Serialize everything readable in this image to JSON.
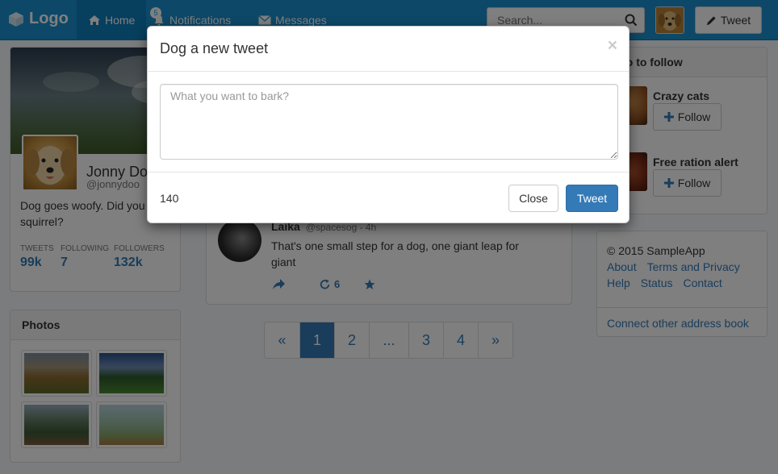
{
  "navbar": {
    "brand": "Logo",
    "brand_icon": "cube-icon",
    "home_label": "Home",
    "notifications_label": "Notifications",
    "notifications_count": "5",
    "messages_label": "Messages",
    "search_placeholder": "Search...",
    "tweet_label": "Tweet",
    "accent_color": "#1a91d1"
  },
  "profile": {
    "name": "Jonny Doo",
    "handle": "@jonnydoo",
    "bio": "Dog goes woofy. Did you said squirrel?",
    "stats": [
      {
        "label": "TWEETS",
        "value": "99k"
      },
      {
        "label": "FOLLOWING",
        "value": "7"
      },
      {
        "label": "FOLLOWERS",
        "value": "132k"
      }
    ]
  },
  "photos": {
    "title": "Photos"
  },
  "tweet": {
    "author": "Laika",
    "handle_time": "@spacesog - 4h",
    "text": "That's one small step for a dog, one giant leap for giant",
    "retweet_count": "6"
  },
  "pagination": {
    "prev": "«",
    "pages": [
      "1",
      "2",
      "...",
      "3",
      "4"
    ],
    "next": "»",
    "active": "1"
  },
  "who_to_follow": {
    "title": "Who to follow",
    "items": [
      {
        "name": "Crazy cats",
        "button": "Follow"
      },
      {
        "name": "Free ration alert",
        "button": "Follow"
      }
    ]
  },
  "footer": {
    "copyright": "© 2015 SampleApp",
    "links_row1": [
      "About",
      "Terms and Privacy"
    ],
    "links_row2": [
      "Help",
      "Status",
      "Contact"
    ],
    "connect": "Connect other address book"
  },
  "modal": {
    "title": "Dog a new tweet",
    "close_symbol": "×",
    "placeholder": "What you want to bark?",
    "char_count": "140",
    "close_label": "Close",
    "tweet_label": "Tweet",
    "primary_color": "#337ab7"
  }
}
